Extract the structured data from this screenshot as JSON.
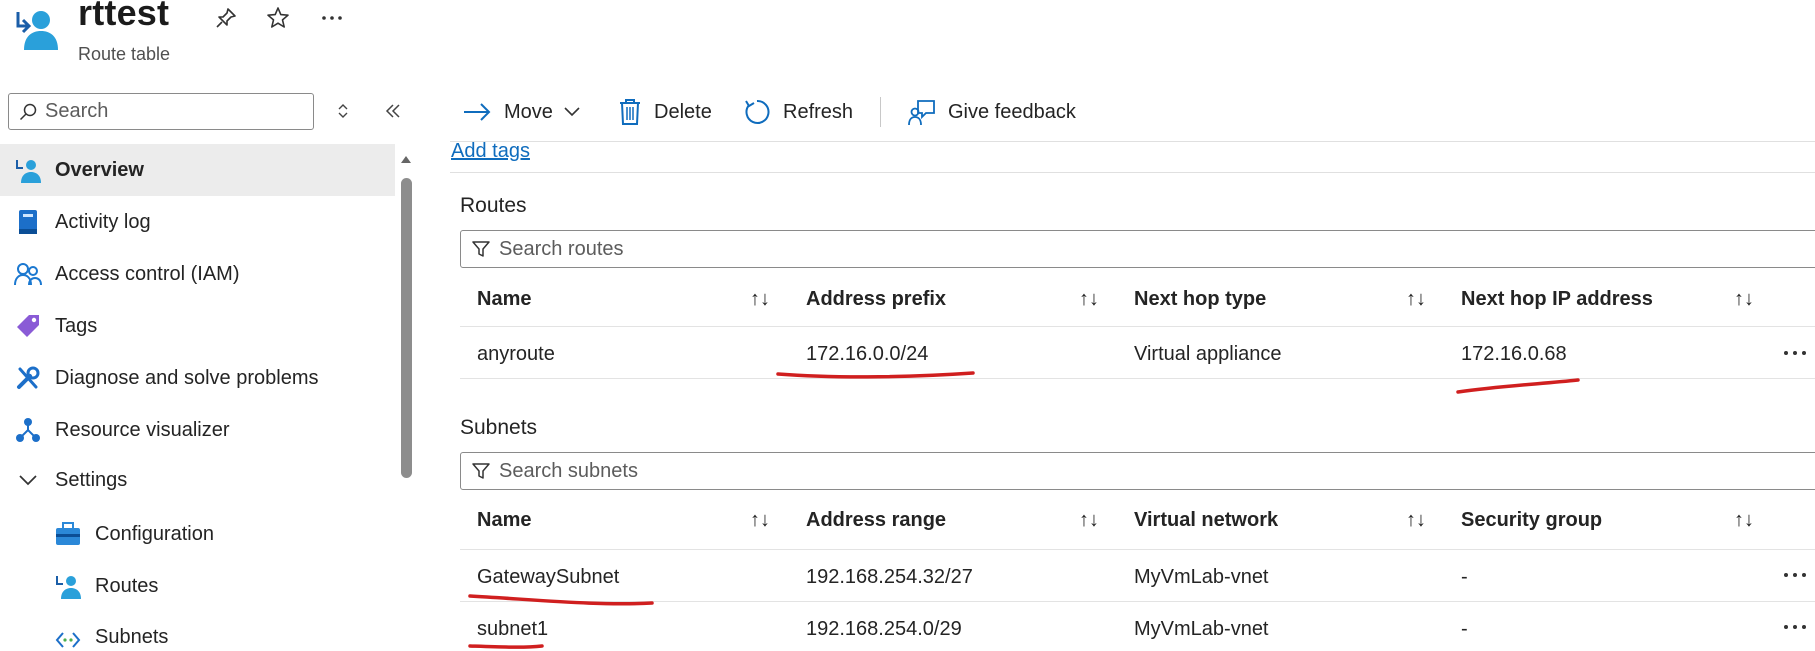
{
  "resource": {
    "title": "rttest",
    "type": "Route table"
  },
  "sidebar": {
    "search_placeholder": "Search",
    "items": [
      {
        "label": "Overview",
        "icon": "route-table-icon"
      },
      {
        "label": "Activity log",
        "icon": "activity-log-icon"
      },
      {
        "label": "Access control (IAM)",
        "icon": "iam-icon"
      },
      {
        "label": "Tags",
        "icon": "tag-icon"
      },
      {
        "label": "Diagnose and solve problems",
        "icon": "wrench-icon"
      },
      {
        "label": "Resource visualizer",
        "icon": "visualizer-icon"
      },
      {
        "label": "Settings",
        "icon": "chevron-down-icon"
      },
      {
        "label": "Configuration",
        "icon": "toolbox-icon"
      },
      {
        "label": "Routes",
        "icon": "route-icon"
      },
      {
        "label": "Subnets",
        "icon": "subnet-icon"
      }
    ]
  },
  "toolbar": {
    "move": "Move",
    "delete": "Delete",
    "refresh": "Refresh",
    "feedback": "Give feedback"
  },
  "add_tags": "Add tags",
  "routes": {
    "title": "Routes",
    "search_placeholder": "Search routes",
    "columns": [
      "Name",
      "Address prefix",
      "Next hop type",
      "Next hop IP address"
    ],
    "rows": [
      {
        "name": "anyroute",
        "prefix": "172.16.0.0/24",
        "hop_type": "Virtual appliance",
        "hop_ip": "172.16.0.68"
      }
    ]
  },
  "subnets": {
    "title": "Subnets",
    "search_placeholder": "Search subnets",
    "columns": [
      "Name",
      "Address range",
      "Virtual network",
      "Security group"
    ],
    "rows": [
      {
        "name": "GatewaySubnet",
        "range": "192.168.254.32/27",
        "vnet": "MyVmLab-vnet",
        "nsg": "-"
      },
      {
        "name": "subnet1",
        "range": "192.168.254.0/29",
        "vnet": "MyVmLab-vnet",
        "nsg": "-"
      }
    ]
  },
  "colors": {
    "accent": "#0f6cbd",
    "annotation": "#d01f1f",
    "selected_bg": "#ececec"
  }
}
